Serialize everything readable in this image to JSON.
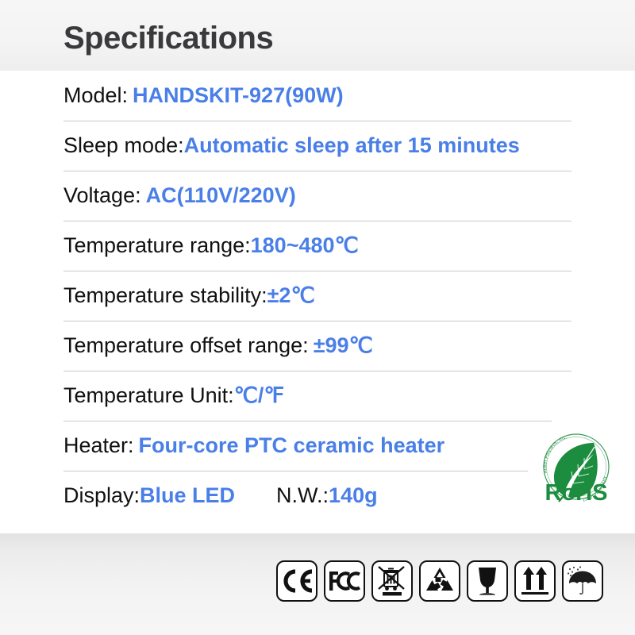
{
  "header": {
    "title": "Specifications"
  },
  "colors": {
    "value_blue": "#4a7fe8",
    "label_black": "#111111",
    "title_gray": "#3a3a3c",
    "divider_gray": "#c9c9c9",
    "band_gray": "#f2f2f2",
    "rohs_green": "#1a8a3c"
  },
  "specs": [
    {
      "label": "Model:",
      "value": "HANDSKIT-927(90W)"
    },
    {
      "label": "Sleep mode:",
      "value": "Automatic sleep after 15 minutes"
    },
    {
      "label": "Voltage:",
      "value": "AC(110V/220V)"
    },
    {
      "label": "Temperature range:",
      "value": "180~480℃"
    },
    {
      "label": "Temperature stability:",
      "value": "±2℃"
    },
    {
      "label": "Temperature offset range:",
      "value": "±99℃"
    },
    {
      "label": "Temperature Unit:",
      "value": "℃/℉"
    },
    {
      "label": "Heater:",
      "value": "Four-core PTC ceramic heater"
    },
    {
      "label": "Display:",
      "value": "Blue LED",
      "label2": "N.W.:",
      "value2": "140g"
    }
  ],
  "rohs": {
    "text": "RoHS",
    "ring_text_left": "AcBel Polytech, Inc.",
    "ring_text_right": "Green Product"
  },
  "certifications": [
    {
      "name": "ce-mark-icon",
      "label": "CE"
    },
    {
      "name": "fcc-mark-icon",
      "label": "FCC"
    },
    {
      "name": "weee-bin-icon",
      "label": "WEEE"
    },
    {
      "name": "recycling-loop-icon",
      "label": "Recycle"
    },
    {
      "name": "fragile-glass-icon",
      "label": "Fragile"
    },
    {
      "name": "this-side-up-icon",
      "label": "This Side Up"
    },
    {
      "name": "keep-dry-umbrella-icon",
      "label": "Keep Dry"
    }
  ]
}
